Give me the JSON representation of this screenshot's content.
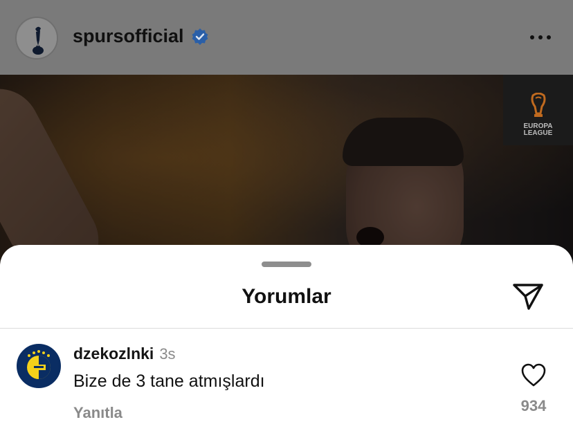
{
  "post": {
    "username": "spursofficial",
    "verified": true,
    "avatar_icon": "spurs-cockerel-logo",
    "more_icon": "more-horizontal-icon",
    "badge_text_line1": "EUROPA",
    "badge_text_line2": "LEAGUE",
    "badge_icon": "uefa-europa-league-trophy-icon"
  },
  "sheet": {
    "title": "Yorumlar",
    "share_icon": "send-paper-plane-icon"
  },
  "comment": {
    "username": "dzekozlnki",
    "time": "3s",
    "text": "Bize de 3 tane atmışlardı",
    "reply_label": "Yanıtla",
    "like_count": "934",
    "avatar_icon": "fenerbahce-logo",
    "like_icon": "heart-outline-icon"
  },
  "colors": {
    "verified_blue": "#2a7cf6",
    "secondary_text": "#8a8a8a",
    "fener_navy": "#0a2d63",
    "fener_yellow": "#f4d11a"
  }
}
